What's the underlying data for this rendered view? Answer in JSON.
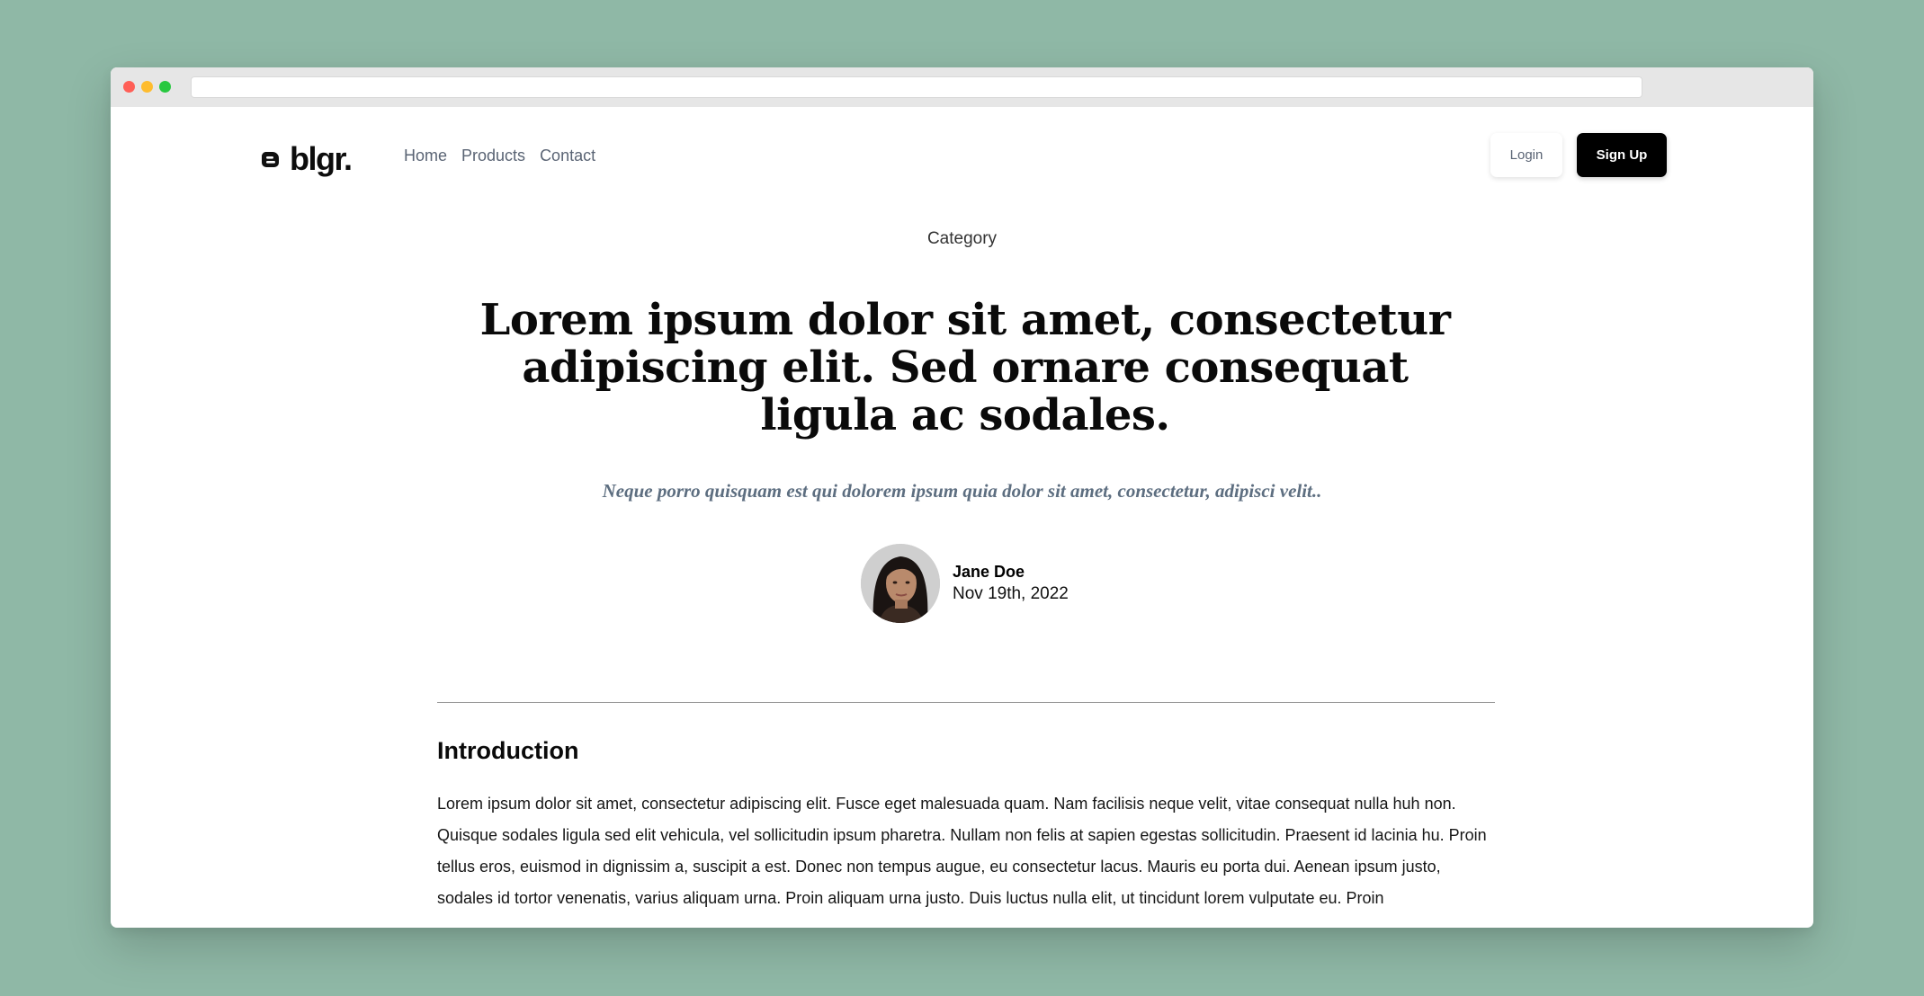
{
  "nav": {
    "brand": "blgr.",
    "links": [
      {
        "label": "Home"
      },
      {
        "label": "Products"
      },
      {
        "label": "Contact"
      }
    ],
    "login_label": "Login",
    "signup_label": "Sign Up"
  },
  "article": {
    "category": "Category",
    "title": "Lorem ipsum dolor sit amet, consectetur adipiscing elit. Sed ornare consequat ligula ac sodales.",
    "subtitle": "Neque porro quisquam est qui dolorem ipsum quia dolor sit amet, consectetur, adipisci velit..",
    "author": {
      "name": "Jane Doe",
      "date": "Nov 19th, 2022",
      "avatar_icon": "person-portrait-icon"
    },
    "section": {
      "heading": "Introduction",
      "paragraph": "Lorem ipsum dolor sit amet, consectetur adipiscing elit. Fusce eget malesuada quam. Nam facilisis neque velit, vitae consequat nulla huh non. Quisque sodales ligula sed elit vehicula, vel sollicitudin ipsum pharetra. Nullam non felis at sapien egestas sollicitudin. Praesent id lacinia hu. Proin tellus eros, euismod in dignissim a, suscipit a est. Donec non tempus augue, eu consectetur lacus. Mauris eu porta dui. Aenean ipsum justo, sodales id tortor venenatis, varius aliquam urna. Proin aliquam urna justo. Duis luctus nulla elit, ut tincidunt lorem vulputate eu. Proin"
    }
  },
  "colors": {
    "background": "#8fb8a6",
    "accent_button": "#000000",
    "subtitle": "#5d6e80",
    "nav_link": "#5a6474"
  }
}
